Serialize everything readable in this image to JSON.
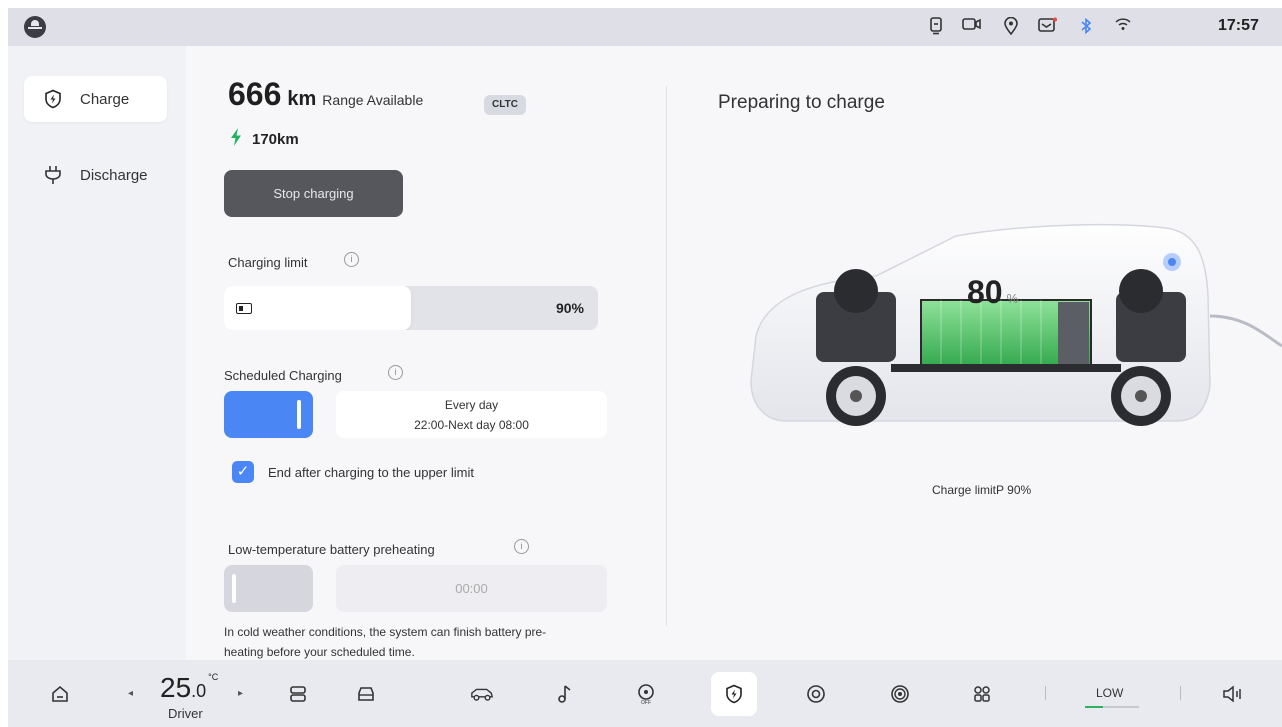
{
  "status_bar": {
    "time": "17:57",
    "icons": [
      "profile-icon",
      "phone-icon",
      "camera-icon",
      "location-icon",
      "message-icon",
      "bluetooth-icon",
      "wifi-icon"
    ]
  },
  "sidebar": {
    "items": [
      {
        "label": "Charge",
        "icon": "charge-shield-icon",
        "active": true
      },
      {
        "label": "Discharge",
        "icon": "plug-icon",
        "active": false
      }
    ]
  },
  "range": {
    "value": "666",
    "unit": "km",
    "label": "Range Available",
    "badge": "CLTC",
    "electric_range": "170km"
  },
  "stop_button": {
    "label": "Stop charging"
  },
  "charging_limit": {
    "label": "Charging limit",
    "value": "90%",
    "fraction": 0.5
  },
  "scheduled": {
    "label": "Scheduled Charging",
    "enabled": true,
    "repeat": "Every day",
    "window": "22:00-Next day 08:00",
    "end_after_limit_label": "End after charging to the upper limit",
    "end_after_limit_checked": true
  },
  "preheat": {
    "label": "Low-temperature battery preheating",
    "enabled": false,
    "time": "00:00",
    "note": "In cold weather conditions, the system can finish battery pre-heating before your scheduled time."
  },
  "status_panel": {
    "title": "Preparing to charge",
    "soc": "80",
    "soc_unit": "%",
    "charge_limit_text": "Charge limitP 90%"
  },
  "dock": {
    "temperature": "25",
    "temperature_decimal": ".0",
    "temperature_unit": "°C",
    "temperature_label": "Driver",
    "fan_label": "LOW",
    "fan_level": 0.33,
    "colors": {
      "accent": "#4a86f4",
      "green": "#22b35f"
    }
  }
}
